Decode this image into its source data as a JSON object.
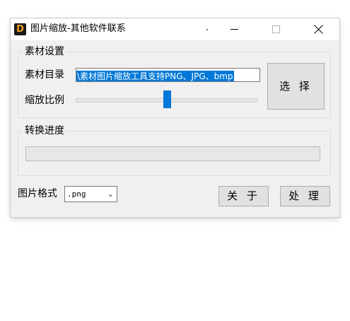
{
  "window": {
    "title": "图片缩放-其他软件联系",
    "icon_letter": "D"
  },
  "settings_group": {
    "legend": "素材设置",
    "material_dir_label": "素材目录",
    "material_dir_value": "\\素材图片缩放工具支持PNG、JPG、bmp",
    "scale_label": "缩放比例",
    "scale_level_percent": 50,
    "select_button": "选 择"
  },
  "progress_group": {
    "legend": "转换进度",
    "progress_percent": 0
  },
  "bottom": {
    "format_label": "图片格式",
    "format_value": ".png",
    "about_button": "关 于",
    "process_button": "处 理"
  },
  "colors": {
    "accent": "#0078d7",
    "window_bg": "#f0f0f0"
  }
}
